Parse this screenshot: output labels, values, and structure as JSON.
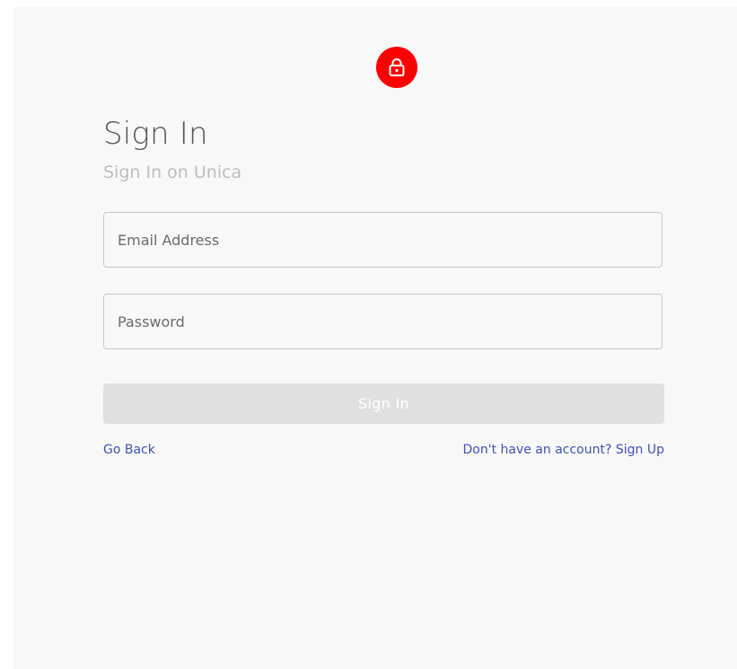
{
  "app": {
    "background_color": "#f8f8f8",
    "accent_color": "#ff0000",
    "link_color": "#3f51b5"
  },
  "header": {
    "icon": "lock-icon",
    "title": "Sign In",
    "subtitle": "Sign In on Unica"
  },
  "form": {
    "email": {
      "placeholder": "Email Address",
      "value": ""
    },
    "password": {
      "placeholder": "Password",
      "value": ""
    },
    "submit_label": "Sign In",
    "submit_enabled": false
  },
  "links": {
    "back_label": "Go Back",
    "signup_label": "Don't have an account? Sign Up"
  }
}
